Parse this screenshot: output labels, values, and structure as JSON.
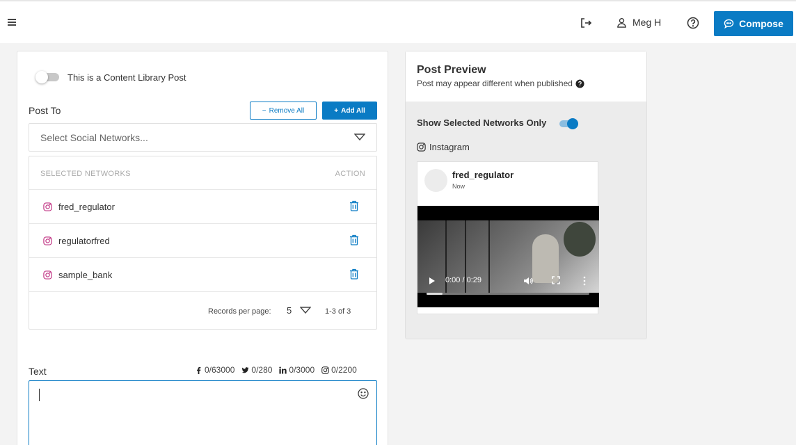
{
  "header": {
    "user_name": "Meg H",
    "compose_label": "Compose",
    "accent_color": "#0a7bc4"
  },
  "form": {
    "content_library_label": "This is a Content Library Post",
    "content_library_on": false,
    "post_to_label": "Post To",
    "remove_all_label": "Remove All",
    "add_all_label": "Add All",
    "select_placeholder": "Select Social Networks...",
    "table": {
      "col_networks": "SELECTED NETWORKS",
      "col_action": "ACTION",
      "rows": [
        {
          "name": "fred_regulator",
          "icon": "instagram-icon"
        },
        {
          "name": "regulatorfred",
          "icon": "instagram-icon"
        },
        {
          "name": "sample_bank",
          "icon": "instagram-icon"
        }
      ],
      "records_per_page_label": "Records per page:",
      "records_per_page": "5",
      "range": "1-3 of 3"
    },
    "text_label": "Text",
    "counters": {
      "facebook": "0/63000",
      "twitter": "0/280",
      "linkedin": "0/3000",
      "instagram": "0/2200"
    },
    "text_value": ""
  },
  "preview": {
    "title": "Post Preview",
    "subtitle": "Post may appear different when published",
    "show_selected_label": "Show Selected Networks Only",
    "show_selected_on": true,
    "network_name": "Instagram",
    "card": {
      "username": "fred_regulator",
      "time": "Now",
      "video_time": "0:00 / 0:29",
      "video_progress": 0.1
    }
  }
}
